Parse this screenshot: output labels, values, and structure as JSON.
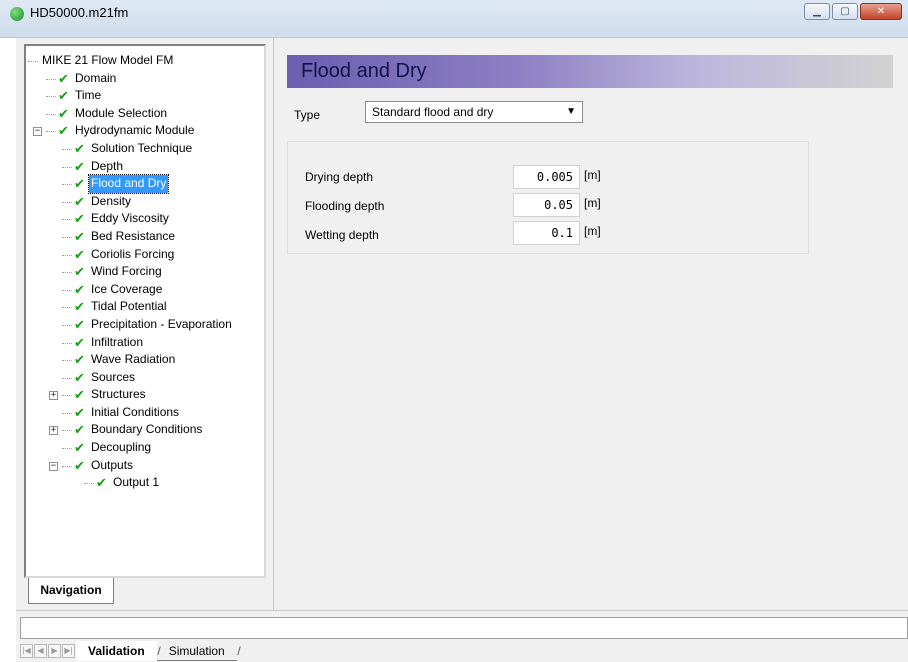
{
  "window": {
    "title": "HD50000.m21fm"
  },
  "tree": {
    "items": [
      {
        "label": "MIKE 21 Flow Model FM",
        "level": 0,
        "check": false,
        "expander": ""
      },
      {
        "label": "Domain",
        "level": 1,
        "check": true,
        "expander": ""
      },
      {
        "label": "Time",
        "level": 1,
        "check": true,
        "expander": ""
      },
      {
        "label": "Module Selection",
        "level": 1,
        "check": true,
        "expander": ""
      },
      {
        "label": "Hydrodynamic Module",
        "level": 1,
        "check": true,
        "expander": "−"
      },
      {
        "label": "Solution Technique",
        "level": 2,
        "check": true,
        "expander": ""
      },
      {
        "label": "Depth",
        "level": 2,
        "check": true,
        "expander": ""
      },
      {
        "label": "Flood and Dry",
        "level": 2,
        "check": true,
        "expander": "",
        "selected": true
      },
      {
        "label": "Density",
        "level": 2,
        "check": true,
        "expander": ""
      },
      {
        "label": "Eddy Viscosity",
        "level": 2,
        "check": true,
        "expander": ""
      },
      {
        "label": "Bed Resistance",
        "level": 2,
        "check": true,
        "expander": ""
      },
      {
        "label": "Coriolis Forcing",
        "level": 2,
        "check": true,
        "expander": ""
      },
      {
        "label": "Wind Forcing",
        "level": 2,
        "check": true,
        "expander": ""
      },
      {
        "label": "Ice Coverage",
        "level": 2,
        "check": true,
        "expander": ""
      },
      {
        "label": "Tidal Potential",
        "level": 2,
        "check": true,
        "expander": ""
      },
      {
        "label": "Precipitation - Evaporation",
        "level": 2,
        "check": true,
        "expander": ""
      },
      {
        "label": "Infiltration",
        "level": 2,
        "check": true,
        "expander": ""
      },
      {
        "label": "Wave Radiation",
        "level": 2,
        "check": true,
        "expander": ""
      },
      {
        "label": "Sources",
        "level": 2,
        "check": true,
        "expander": ""
      },
      {
        "label": "Structures",
        "level": 2,
        "check": true,
        "expander": "+"
      },
      {
        "label": "Initial Conditions",
        "level": 2,
        "check": true,
        "expander": ""
      },
      {
        "label": "Boundary Conditions",
        "level": 2,
        "check": true,
        "expander": "+"
      },
      {
        "label": "Decoupling",
        "level": 2,
        "check": true,
        "expander": ""
      },
      {
        "label": "Outputs",
        "level": 2,
        "check": true,
        "expander": "−"
      },
      {
        "label": "Output 1",
        "level": 3,
        "check": true,
        "expander": ""
      }
    ]
  },
  "nav_tab": "Navigation",
  "panel": {
    "title": "Flood and Dry",
    "type_label": "Type",
    "type_value": "Standard flood and dry",
    "fields": [
      {
        "label": "Drying depth",
        "value": "0.005",
        "unit": "[m]"
      },
      {
        "label": "Flooding depth",
        "value": "0.05",
        "unit": "[m]"
      },
      {
        "label": "Wetting depth",
        "value": "0.1",
        "unit": "[m]"
      }
    ]
  },
  "bottom_tabs": [
    "Validation",
    "Simulation"
  ],
  "colors": {
    "header_gradient_start": "#6b5eb0",
    "selection": "#3399ff",
    "check": "#16a016"
  }
}
